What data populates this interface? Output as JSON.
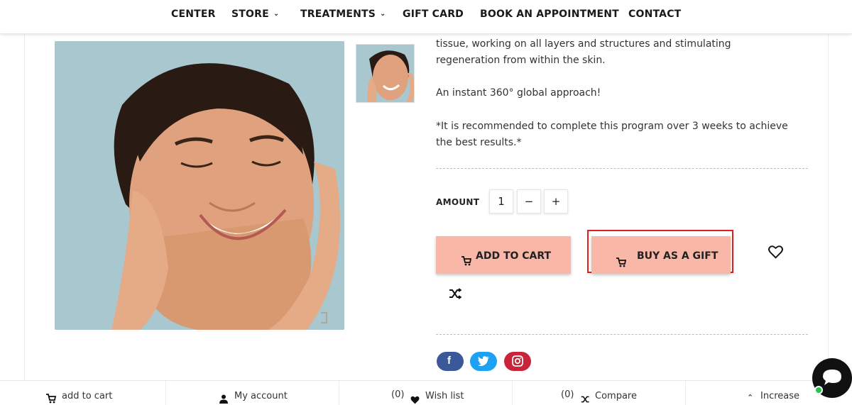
{
  "nav": {
    "center": "CENTER",
    "store": "STORE",
    "treatments": "TREATMENTS",
    "gift_card": "GIFT CARD",
    "book": "BOOK AN APPOINTMENT",
    "contact": "CONTACT"
  },
  "description": {
    "line1": "tissue, working on all layers and structures and stimulating",
    "line2": "regeneration from within the skin.",
    "approach": "An instant 360° global approach!",
    "note1": "*It is recommended to complete this program over 3 weeks to achieve",
    "note2": "the best results.*"
  },
  "quantity": {
    "label": "AMOUNT",
    "value": "1",
    "minus": "−",
    "plus": "+"
  },
  "actions": {
    "add_to_cart": "ADD TO CART",
    "buy_as_gift": "BUY AS A GIFT"
  },
  "bottom_bar": {
    "add_to_cart": "add to cart",
    "my_account": "My account",
    "wish_count": "(0)",
    "wish_list": "Wish list",
    "compare_count": "(0)",
    "compare": "Compare",
    "increase": "Increase"
  },
  "colors": {
    "button_bg": "#f9b7a7",
    "highlight_border": "#e02020",
    "facebook": "#3b5998",
    "twitter": "#1da1f2",
    "instagram": "#c8243a"
  }
}
